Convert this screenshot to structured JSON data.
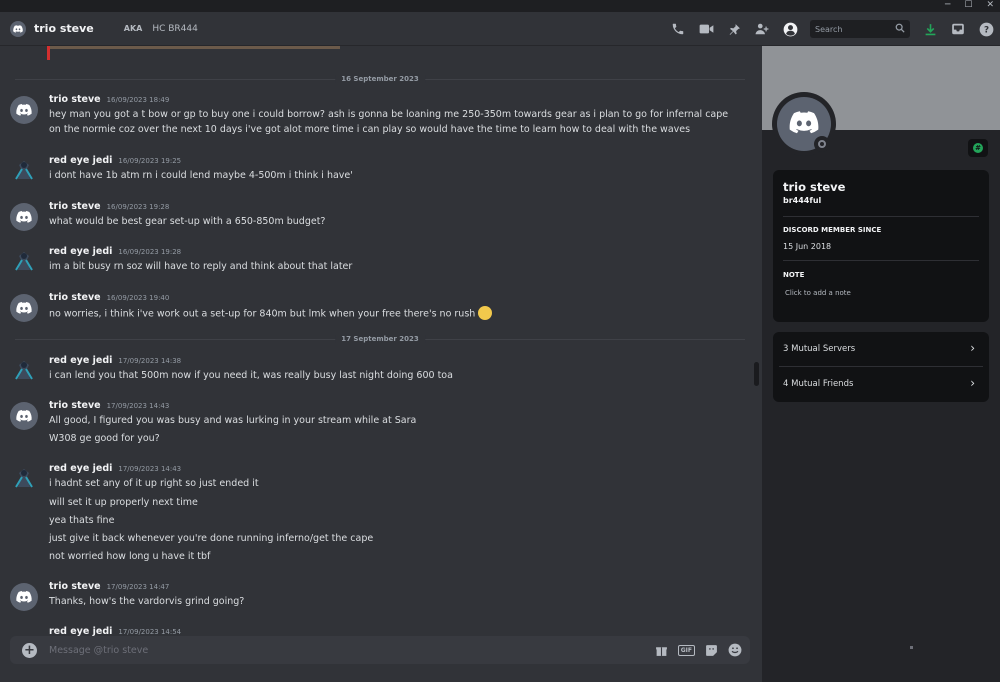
{
  "header": {
    "name": "trio steve",
    "aka_label": "AKA",
    "tag": "HC BR444",
    "search_placeholder": "Search"
  },
  "window_controls": [
    "─",
    "☐",
    "✕"
  ],
  "dividers": [
    "16 September 2023",
    "17 September 2023"
  ],
  "messages": [
    {
      "author": "trio steve",
      "time": "16/09/2023 18:49",
      "avatar": "discord-default",
      "lines": [
        "hey man you got a t bow or gp to buy one i could borrow? ash is gonna be loaning me 250-350m towards gear as i plan to go for infernal cape",
        "on the normie coz over the next 10 days i've got alot more time i can play so would have the time to learn how to deal with the waves"
      ]
    },
    {
      "author": "red eye jedi",
      "time": "16/09/2023 19:25",
      "avatar": "jedi",
      "lines": [
        "i dont have 1b atm rn i could lend maybe 4-500m i think i have'"
      ]
    },
    {
      "author": "trio steve",
      "time": "16/09/2023 19:28",
      "avatar": "discord-default",
      "lines": [
        "what would be best gear set-up with a 650-850m budget?"
      ]
    },
    {
      "author": "red eye jedi",
      "time": "16/09/2023 19:28",
      "avatar": "jedi",
      "lines": [
        "im a bit busy rn soz will have to reply and think about that later"
      ]
    },
    {
      "author": "trio steve",
      "time": "16/09/2023 19:40",
      "avatar": "discord-default",
      "lines": [
        "no worries, i think i've work out a set-up for 840m but lmk when your free there's no rush"
      ]
    },
    {
      "author": "red eye jedi",
      "time": "17/09/2023 14:38",
      "avatar": "jedi",
      "lines": [
        "i can lend you that 500m now if you need it, was really busy last night doing 600 toa"
      ]
    },
    {
      "author": "trio steve",
      "time": "17/09/2023 14:43",
      "avatar": "discord-default",
      "lines": [
        "All good, I figured you was busy and was lurking in your stream while at Sara",
        "W308 ge good for you?"
      ]
    },
    {
      "author": "red eye jedi",
      "time": "17/09/2023 14:43",
      "avatar": "jedi",
      "lines": [
        "i hadnt set any of it up right so just ended it",
        "will set it up properly next time",
        "yea thats fine",
        "just give it back whenever you're done running inferno/get the cape",
        "not worried how long u have it tbf"
      ]
    },
    {
      "author": "trio steve",
      "time": "17/09/2023 14:47",
      "avatar": "discord-default",
      "lines": [
        "Thanks, how's the vardorvis grind going?"
      ]
    },
    {
      "author": "red eye jedi",
      "time": "17/09/2023 14:54",
      "avatar": "jedi",
      "lines": []
    }
  ],
  "composer": {
    "placeholder": "Message @trio steve"
  },
  "profile": {
    "display_name": "trio steve",
    "username": "br444ful",
    "member_since_label": "DISCORD MEMBER SINCE",
    "member_since": "15 Jun 2018",
    "note_label": "NOTE",
    "note_placeholder": "Click to add a note",
    "mutual_servers": "3 Mutual Servers",
    "mutual_friends": "4 Mutual Friends"
  },
  "colors": {
    "bg": "#313338",
    "sidebar": "#232428",
    "card": "#111214",
    "banner": "#909397",
    "accent_green": "#23a55a"
  }
}
